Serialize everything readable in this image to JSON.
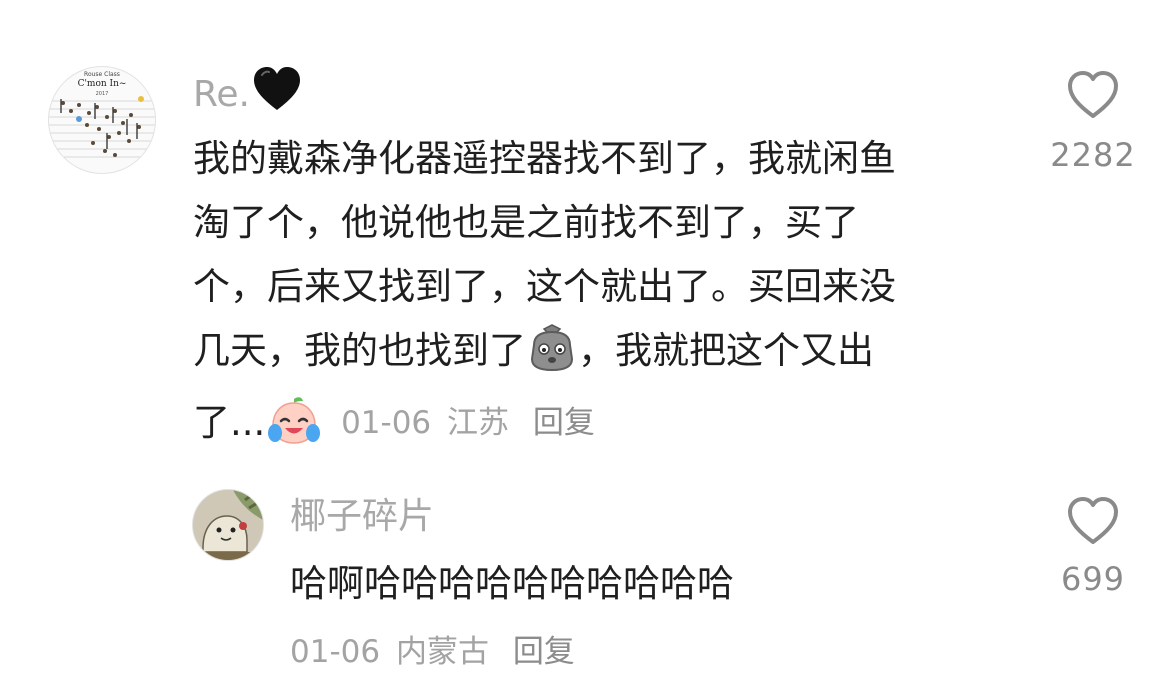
{
  "comment": {
    "username": "Re.",
    "username_emoji": "black-heart",
    "lines": [
      "我的戴森净化器遥控器找不到了，我就闲鱼",
      "淘了个，他说他也是之前找不到了，买了",
      "个，后来又找到了，这个就出了。买回来没",
      "几天，我的也找到了",
      "，我就把这个又出",
      "了..."
    ],
    "date": "01-06",
    "location": "江苏",
    "reply_label": "回复",
    "like_count": "2282",
    "avatar_text": {
      "line1": "Rouse Class",
      "line2": "C'mon In~",
      "line3": "2017"
    }
  },
  "reply": {
    "username": "椰子碎片",
    "text": "哈啊哈哈哈哈哈哈哈哈哈哈",
    "date": "01-06",
    "location": "内蒙古",
    "reply_label": "回复",
    "like_count": "699"
  },
  "colors": {
    "text": "#1f1f1f",
    "username": "#a8a8a8",
    "meta": "#a3a3a3",
    "icon": "#8a8a8a"
  }
}
